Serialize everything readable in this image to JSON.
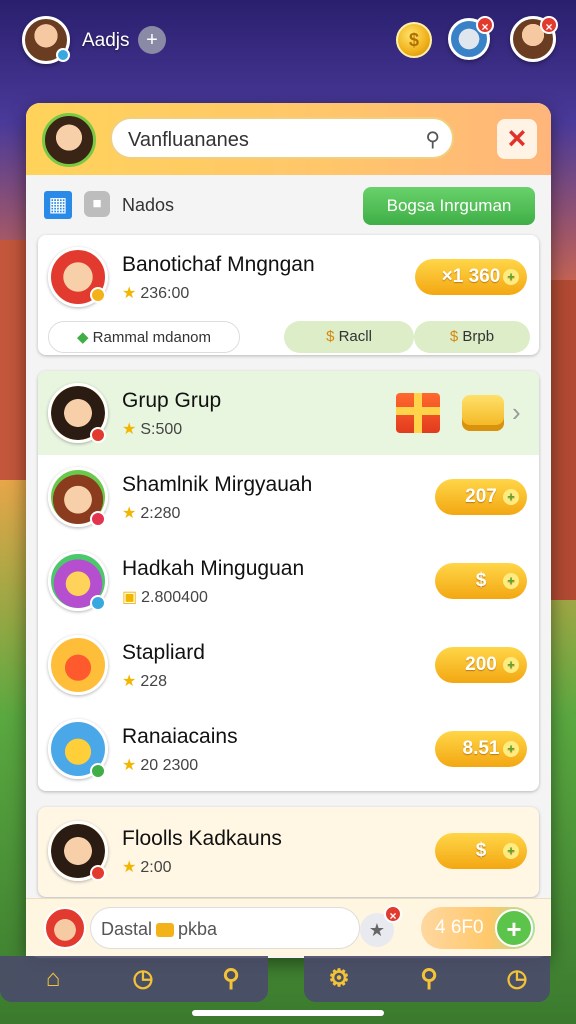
{
  "topbar": {
    "username": "Aadjs",
    "plus_icon": "plus-icon",
    "coin_icon": "coin-icon"
  },
  "panel": {
    "search_value": "Vanfluananes",
    "search_icon": "search-icon",
    "close_icon": "close-icon",
    "toolbar_label": "Nados",
    "toolbar_button": "Bogsa Inrguman"
  },
  "featured": {
    "title": "Banotichaf Mngngan",
    "sub": "236:00",
    "pill": "×1 360",
    "tabs": [
      "Rammal mdanom",
      "Racll",
      "Brpb"
    ]
  },
  "list": [
    {
      "title": "Grup Grup",
      "sub": "S:500"
    },
    {
      "title": "Shamlnik Mirgyauah",
      "sub": "2:280",
      "pill": "207"
    },
    {
      "title": "Hadkah Minguguan",
      "sub": "2.800400",
      "pill": ""
    },
    {
      "title": "Stapliard",
      "sub": "228",
      "pill": "200"
    },
    {
      "title": "Ranaiacains",
      "sub": "20 2300",
      "pill": "8.51"
    }
  ],
  "last_item": {
    "title": "Floolls Kadkauns",
    "sub": "2:00"
  },
  "bottom": {
    "chat_prefix": "Dastal",
    "chat_suffix": "pkba",
    "pill": "4 6F0"
  },
  "colors": {
    "accent_green": "#3fae47",
    "accent_gold": "#f3a712",
    "close_red": "#e0322a"
  }
}
